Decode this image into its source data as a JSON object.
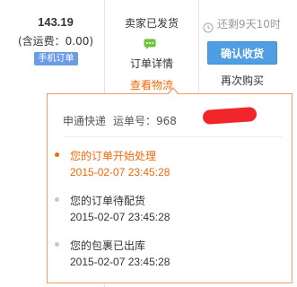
{
  "price": {
    "amount": "143.19",
    "shipping": "(含运费：0.00)",
    "badge": "手机订单"
  },
  "status": {
    "state": "卖家已发货",
    "chat_icon": "chat-bubble-icon",
    "order_detail": "订单详情",
    "view_logistics": "查看物流"
  },
  "actions": {
    "clock_icon": "clock-icon",
    "remaining": "还剩9天10时",
    "confirm": "确认收货",
    "buy_again": "再次购买"
  },
  "logistics": {
    "carrier": "申通快递",
    "tracking_label": "运单号：",
    "tracking_visible": "968",
    "events": [
      {
        "desc": "您的订单开始处理",
        "time": "2015-02-07 23:45:28",
        "active": true
      },
      {
        "desc": "您的订单待配货",
        "time": "2015-02-07 23:45:28",
        "active": false
      },
      {
        "desc": "您的包裹已出库",
        "time": "2015-02-07 23:45:28",
        "active": false
      }
    ]
  },
  "colors": {
    "accent_orange": "#ee6a0a",
    "button_blue": "#4f9ee4",
    "badge_blue": "#6b9de6",
    "redaction_red": "#f0262a"
  }
}
